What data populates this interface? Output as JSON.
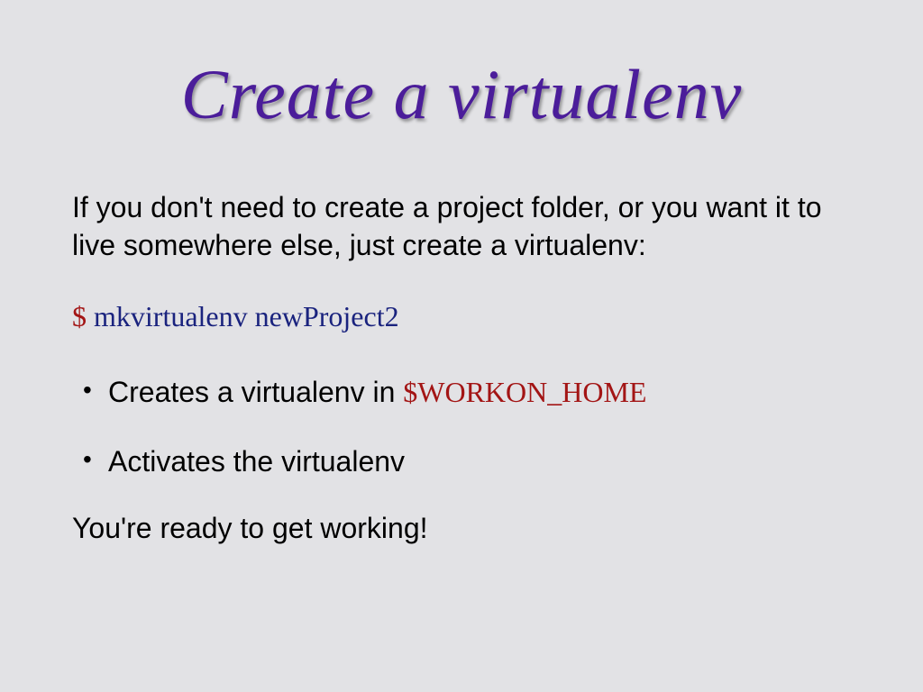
{
  "slide": {
    "title": "Create a virtualenv",
    "intro": "If you don't need to create a project folder, or you want it to live somewhere else, just create a virtualenv:",
    "command": {
      "prompt": "$",
      "text": "mkvirtualenv newProject2"
    },
    "bullets": [
      {
        "prefix": "Creates a virtualenv in ",
        "env": "$WORKON_HOME"
      },
      {
        "prefix": "Activates the virtualenv",
        "env": ""
      }
    ],
    "closing": "You're ready to get working!"
  }
}
